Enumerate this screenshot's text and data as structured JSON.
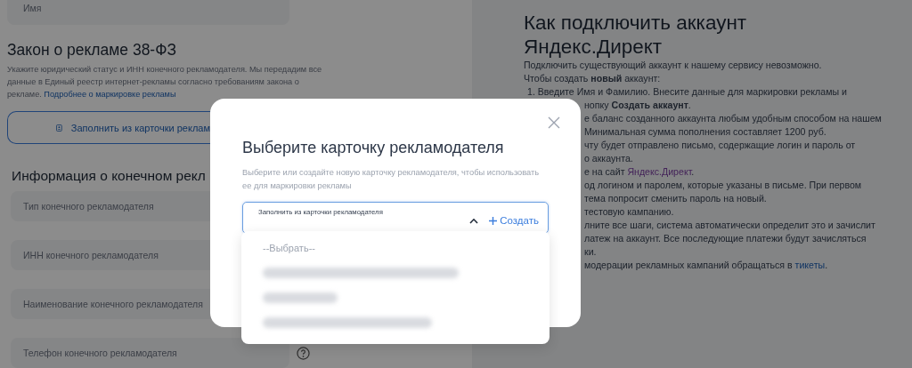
{
  "form": {
    "name_field": {
      "placeholder": "Имя"
    },
    "law_section": {
      "title": "Закон о рекламе 38-ФЗ",
      "text": "Укажите юридический статус и ИНН конечного рекламодателя. Мы передадим все данные в Единый реестр интернет-рекламы согласно требованиям закона о рекламе.",
      "link": "Подробнее о маркировке рекламы"
    },
    "fill_button": {
      "label": "Заполнить из карточки реклам"
    },
    "info_section": {
      "title": "Информация о конечном рекл",
      "fields": [
        {
          "placeholder": "Тип конечного рекламодателя",
          "help": false
        },
        {
          "placeholder": "ИНН конечного рекламодателя",
          "help": false
        },
        {
          "placeholder": "Наименование конечного рекламодателя",
          "help": false
        },
        {
          "placeholder": "Телефон конечного рекламодателя",
          "help": true
        }
      ]
    }
  },
  "instructions": {
    "title": "Как подключить аккаунт Яндекс.Директ",
    "lines": [
      {
        "kind": "text",
        "text": "Подключить существующий аккаунт к нашему сервису невозможно."
      },
      {
        "kind": "text",
        "text": "Чтобы создать **новый** аккаунт:"
      },
      {
        "kind": "item",
        "text": "1. Введите Имя и Фамилию. Внесите данные для маркировки рекламы и"
      },
      {
        "kind": "fragment",
        "text": "нопку **Создать аккаунт**."
      },
      {
        "kind": "fragment",
        "text": "е баланс созданного аккаунта любым удобным способом на нашем"
      },
      {
        "kind": "fragment",
        "text": "Минимальная сумма пополнения составляет 1200 руб."
      },
      {
        "kind": "fragment",
        "text": "чту будет отправлено письмо, содержащие логин и пароль от"
      },
      {
        "kind": "fragment",
        "text": "о аккаунта."
      },
      {
        "kind": "link",
        "before": "е на сайт ",
        "link": "Яндекс.Директ",
        "after": ".",
        "visited": true
      },
      {
        "kind": "fragment",
        "text": "од логином и паролем, которые указаны в письме. При первом"
      },
      {
        "kind": "fragment",
        "text": "тема попросит сменить пароль на новый."
      },
      {
        "kind": "fragment",
        "text": "тестовую кампанию."
      },
      {
        "kind": "fragment",
        "text": "лните все шаги, система автоматически определит это и зачислит"
      },
      {
        "kind": "fragment",
        "text": "латеж на аккаунт. Все последующие платежи будут зачисляться"
      },
      {
        "kind": "fragment",
        "text": "ки."
      },
      {
        "kind": "link",
        "before": "модерации рекламных кампаний обращаться в ",
        "link": "тикеты",
        "after": ".",
        "visited": false
      }
    ]
  },
  "modal": {
    "title": "Выберите карточку рекламодателя",
    "description": "Выберите или создайте новую карточку рекламодателя, чтобы использовать ее для маркировки рекламы",
    "select": {
      "label": "Заполнить из карточки рекламодателя",
      "expanded": true,
      "create": "Создать"
    },
    "options": [
      {
        "kind": "text",
        "label": "--Выбрать--"
      },
      {
        "kind": "redacted"
      },
      {
        "kind": "redacted"
      },
      {
        "kind": "redacted"
      }
    ]
  }
}
